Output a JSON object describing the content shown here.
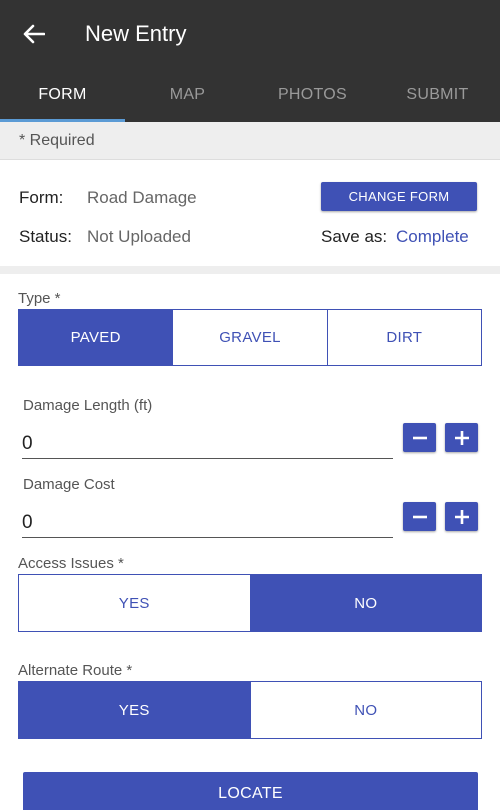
{
  "header": {
    "title": "New Entry"
  },
  "tabs": [
    {
      "label": "FORM",
      "active": true
    },
    {
      "label": "MAP",
      "active": false
    },
    {
      "label": "PHOTOS",
      "active": false
    },
    {
      "label": "SUBMIT",
      "active": false
    }
  ],
  "required_note": "* Required",
  "info": {
    "form_label": "Form:",
    "form_value": "Road Damage",
    "change_form_label": "CHANGE FORM",
    "status_label": "Status:",
    "status_value": "Not Uploaded",
    "save_as_label": "Save as:",
    "save_as_value": "Complete"
  },
  "type_field": {
    "label": "Type *",
    "options": [
      "PAVED",
      "GRAVEL",
      "DIRT"
    ],
    "selected": "PAVED"
  },
  "damage_length": {
    "label": "Damage Length (ft)",
    "value": "0"
  },
  "damage_cost": {
    "label": "Damage Cost",
    "value": "0"
  },
  "access_issues": {
    "label": "Access Issues *",
    "options": [
      "YES",
      "NO"
    ],
    "selected": "NO"
  },
  "alternate_route": {
    "label": "Alternate Route *",
    "options": [
      "YES",
      "NO"
    ],
    "selected": "YES"
  },
  "locate_label": "LOCATE",
  "colors": {
    "appbar": "#333333",
    "accent": "#3f51b5",
    "tab_indicator": "#5b9bd5"
  },
  "icons": {
    "back": "arrow-left-icon",
    "minus": "minus-icon",
    "plus": "plus-icon"
  }
}
